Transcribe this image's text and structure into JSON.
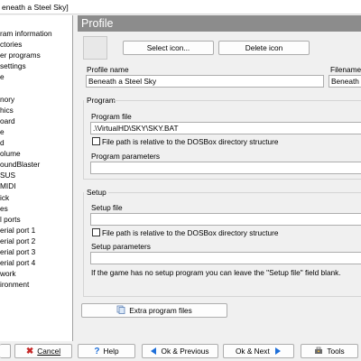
{
  "window": {
    "title": "eneath a Steel Sky]"
  },
  "tree": {
    "items": [
      "ram information",
      "ctories",
      "er programs",
      "settings",
      "e",
      "",
      "nory",
      "hics",
      "oard",
      "e",
      "d",
      "olume",
      "oundBlaster",
      "SUS",
      "MIDI",
      "ick",
      "es",
      "l ports",
      "erial port 1",
      "erial port 2",
      "erial port 3",
      "erial port 4",
      "work",
      "ironment"
    ]
  },
  "panel": {
    "title": "Profile"
  },
  "profile": {
    "select_icon_label": "Select icon...",
    "delete_icon_label": "Delete icon",
    "profile_name_label": "Profile name",
    "profile_name_value": "Beneath a Steel Sky",
    "filename_label": "Filename",
    "filename_value": "Beneath a"
  },
  "program": {
    "group_label": "Program",
    "file_label": "Program file",
    "file_value": ".\\VirtualHD\\SKY\\SKY.BAT",
    "relative_label": "File path is relative to the DOSBox directory structure",
    "params_label": "Program parameters",
    "params_value": ""
  },
  "setup": {
    "group_label": "Setup",
    "file_label": "Setup file",
    "file_value": "",
    "relative_label": "File path is relative to the DOSBox directory structure",
    "params_label": "Setup parameters",
    "params_value": "",
    "hint": "If the game has no setup program you can leave the \"Setup file\" field blank."
  },
  "extra": {
    "label": "Extra program files"
  },
  "buttons": {
    "cancel": "Cancel",
    "help": "Help",
    "ok_previous": "Ok & Previous",
    "ok_next": "Ok & Next",
    "tools": "Tools"
  },
  "colors": {
    "header_bg": "#8c8c8c",
    "accent_blue": "#1e6fd9",
    "cancel_red": "#c62828"
  }
}
